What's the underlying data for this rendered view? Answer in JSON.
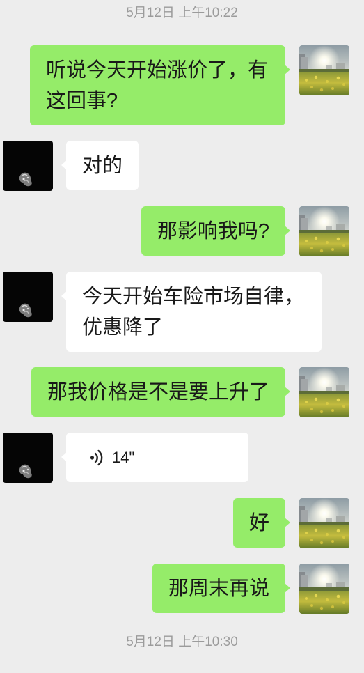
{
  "timestamps": {
    "top": "5月12日 上午10:22",
    "bottom": "5月12日 上午10:30"
  },
  "avatars": {
    "self": "landscape-photo-avatar",
    "contact": "dark-photo-avatar"
  },
  "messages": [
    {
      "sender": "self",
      "type": "text",
      "text": "听说今天开始涨价了，有这回事?"
    },
    {
      "sender": "contact",
      "type": "text",
      "text": "对的"
    },
    {
      "sender": "self",
      "type": "text",
      "text": "那影响我吗?"
    },
    {
      "sender": "contact",
      "type": "text",
      "text": "今天开始车险市场自律，优惠降了"
    },
    {
      "sender": "self",
      "type": "text",
      "text": "那我价格是不是要上升了"
    },
    {
      "sender": "contact",
      "type": "voice",
      "icon": "voice-icon",
      "duration": "14\""
    },
    {
      "sender": "self",
      "type": "text",
      "text": "好"
    },
    {
      "sender": "self",
      "type": "text",
      "text": "那周末再说"
    }
  ],
  "colors": {
    "background": "#ededed",
    "sent_bubble": "#95ec69",
    "received_bubble": "#ffffff",
    "timestamp_text": "#9b9b9b",
    "message_text": "#191919"
  }
}
